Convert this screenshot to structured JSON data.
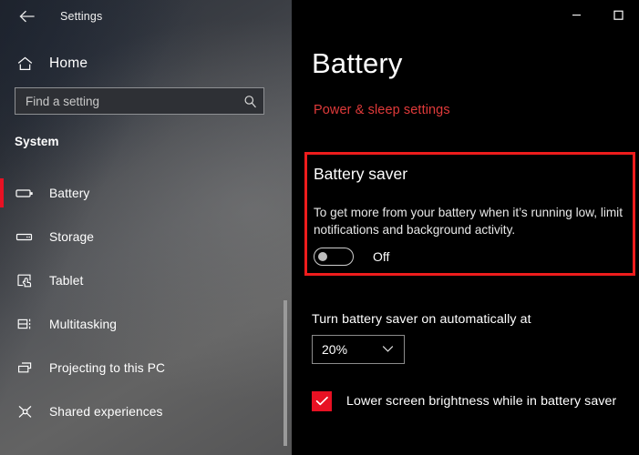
{
  "sidebar": {
    "back_icon": "back-arrow-icon",
    "app_title": "Settings",
    "home": {
      "icon": "home-icon",
      "label": "Home"
    },
    "search": {
      "placeholder": "Find a setting",
      "value": "",
      "icon": "search-icon"
    },
    "section_header": "System",
    "items": [
      {
        "label": "Battery",
        "icon": "battery-icon",
        "selected": true
      },
      {
        "label": "Storage",
        "icon": "storage-drive-icon",
        "selected": false
      },
      {
        "label": "Tablet",
        "icon": "tablet-touch-icon",
        "selected": false
      },
      {
        "label": "Multitasking",
        "icon": "multitasking-icon",
        "selected": false
      },
      {
        "label": "Projecting to this PC",
        "icon": "projecting-screens-icon",
        "selected": false
      },
      {
        "label": "Shared experiences",
        "icon": "share-nodes-icon",
        "selected": false
      }
    ],
    "selection_accent": "#e81123"
  },
  "window_controls": {
    "minimize": {
      "icon": "minimize-icon",
      "label": "—"
    },
    "maximize": {
      "icon": "maximize-icon",
      "label": "□"
    }
  },
  "main": {
    "page_title": "Battery",
    "power_sleep_link": "Power & sleep settings",
    "link_color": "#e03a3a",
    "battery_saver": {
      "heading": "Battery saver",
      "description": "To get more from your battery when it’s running low, limit notifications and background activity.",
      "toggle_state": "Off",
      "toggle_on": false,
      "highlight_color": "#ee1c1c"
    },
    "auto_on": {
      "label": "Turn battery saver on automatically at",
      "selected_value": "20%",
      "chevron_icon": "chevron-down-icon"
    },
    "lower_brightness": {
      "label": "Lower screen brightness while in battery saver",
      "checked": true,
      "checkbox_color": "#e81123",
      "check_icon": "checkmark-icon"
    }
  }
}
